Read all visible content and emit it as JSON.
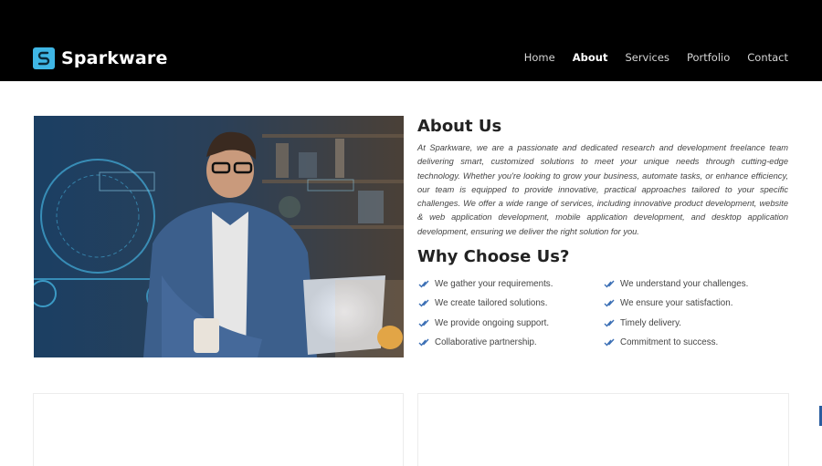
{
  "brand": {
    "name": "Sparkware",
    "logo_icon": "sparkware-logo-icon",
    "accent": "#3fb6e5"
  },
  "nav": {
    "items": [
      {
        "label": "Home",
        "active": false
      },
      {
        "label": "About",
        "active": true
      },
      {
        "label": "Services",
        "active": false
      },
      {
        "label": "Portfolio",
        "active": false
      },
      {
        "label": "Contact",
        "active": false
      }
    ]
  },
  "hero_image": {
    "alt_icon": "developer-at-laptop-image"
  },
  "about": {
    "title": "About Us",
    "text": "At Sparkware, we are a passionate and dedicated research and development freelance team delivering smart, customized solutions to meet your unique needs through cutting-edge technology. Whether you're looking to grow your business, automate tasks, or enhance efficiency, our team is equipped to provide innovative, practical approaches tailored to your specific challenges. We offer a wide range of services, including innovative product development, website & web application development, mobile application development, and desktop application development, ensuring we deliver the right solution for you."
  },
  "why": {
    "title": "Why Choose Us?",
    "check_color": "#3b6fb5",
    "items": [
      "We gather your requirements.",
      "We understand your challenges.",
      "We create tailored solutions.",
      "We ensure your satisfaction.",
      "We provide ongoing support.",
      "Timely delivery.",
      "Collaborative partnership.",
      "Commitment to success."
    ]
  }
}
